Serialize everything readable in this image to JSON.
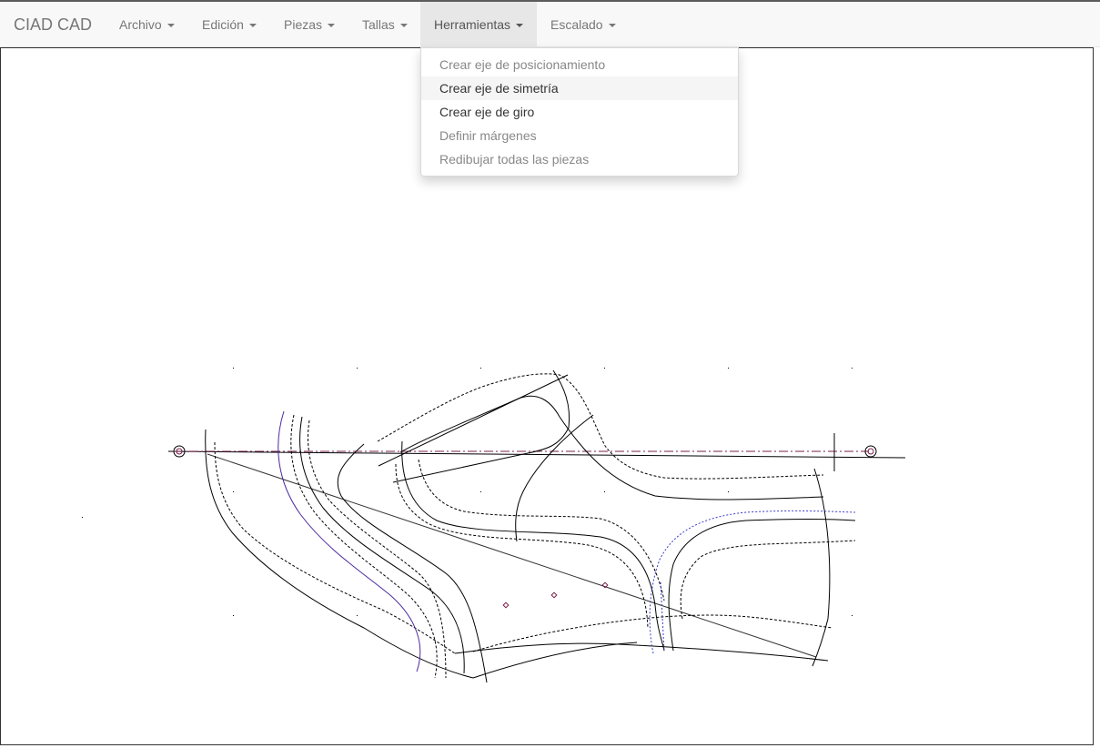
{
  "navbar": {
    "brand": "CIAD CAD",
    "menus": [
      {
        "label": "Archivo"
      },
      {
        "label": "Edición"
      },
      {
        "label": "Piezas"
      },
      {
        "label": "Tallas"
      },
      {
        "label": "Herramientas",
        "open": true
      },
      {
        "label": "Escalado"
      }
    ]
  },
  "dropdown": {
    "items": [
      {
        "label": "Crear eje de posicionamiento",
        "enabled": false
      },
      {
        "label": "Crear eje de simetría",
        "enabled": true,
        "hovered": true
      },
      {
        "label": "Crear eje de giro",
        "enabled": true
      },
      {
        "label": "Definir márgenes",
        "enabled": false
      },
      {
        "label": "Redibujar todas las piezas",
        "enabled": false
      }
    ]
  },
  "colors": {
    "line": "#000000",
    "axis": "#7a1f4a",
    "curve_purple": "#4b2a9e",
    "dotted_blue": "#3a3acc",
    "caret": "#777777"
  }
}
